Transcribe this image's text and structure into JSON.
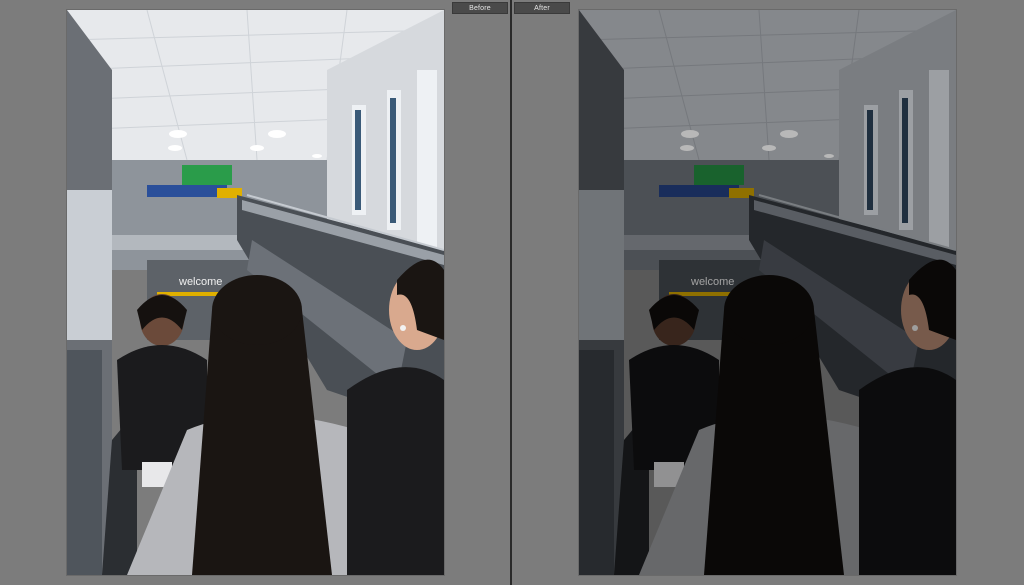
{
  "labels": {
    "before": "Before",
    "after": "After"
  },
  "photo": {
    "description_icon": "photo-scene-icon",
    "colors": {
      "ceiling": "#e7e9ec",
      "wall_light": "#cfd3d8",
      "wall_dark": "#5d6167",
      "sign_green": "#2a9c4a",
      "sign_blue": "#2a4f9a",
      "escalator_metal": "#9aa0a7",
      "hair": "#1a1512",
      "jacket": "#1b1b1d",
      "hoodie": "#b6b7bb"
    }
  },
  "scene_signage": {
    "text": "welcome"
  }
}
